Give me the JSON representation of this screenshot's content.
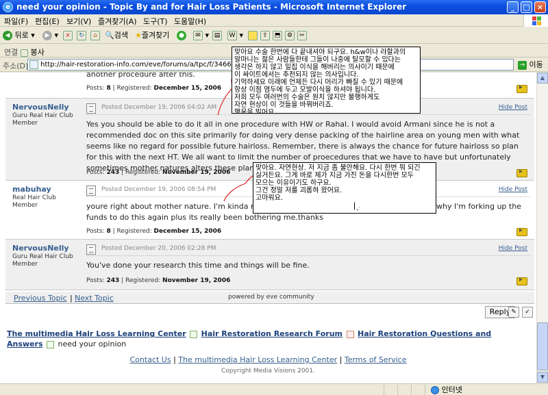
{
  "window": {
    "title": "need your opinion - Topic By and for Hair Loss Patients - Microsoft Internet Explorer",
    "ie_icon": "e"
  },
  "menu": [
    "파일(F)",
    "편집(E)",
    "보기(V)",
    "즐겨찾기(A)",
    "도구(T)",
    "도움말(H)"
  ],
  "toolbar": {
    "back": "뒤로",
    "search": "검색",
    "favorites": "즐겨찾기"
  },
  "links_bar": {
    "label": "연결",
    "item": "봉사"
  },
  "address": {
    "label": "주소(D)",
    "url": "http://hair-restoration-info.com/eve/forums/a/tpc/f/346606086",
    "go": "이동"
  },
  "posts": [
    {
      "tail_text": "another procedure after this.",
      "posts_count": "8",
      "registered": "December 15, 2006"
    },
    {
      "author": "NervousNelly",
      "role": "Guru Real Hair Club",
      "status": "Member",
      "date": "Posted December 19, 2006 04:02 AM",
      "hide": "Hide Post",
      "body": "Yes you should be able to do it all in one procedure with HW or Rahal. I would avoid Armani since he is not a recommended doc on this site primarily for doing very dense packing of the hairline area on young men with what seems like no regard for possible future hairloss. Remember, there is always the chance for future hairloss so plan for this with the next HT. We all want to limit the number of proecedures that we have to have but unfortunately sometimes mother natures alters these plans. Good luck.",
      "posts_count": "243",
      "registered": "November 19, 2006"
    },
    {
      "author": "mabuhay",
      "role": "Real Hair Club",
      "status": "Member",
      "date": "Posted December 19, 2006 08:54 PM",
      "hide": "Hide Post",
      "body": "youre right about mother nature. I'm kinda nervous coz i'd hate to get f      up again. That is why I'm forking up the funds to do this again plus its really been bothering me.thanks",
      "posts_count": "8",
      "registered": "December 15, 2006"
    },
    {
      "author": "NervousNelly",
      "role": "Guru Real Hair Club",
      "status": "Member",
      "date": "Posted December 20, 2006 02:28 PM",
      "hide": "Hide Post",
      "body": "You've done your research this time and things will be fine.",
      "posts_count": "243",
      "registered": "November 19, 2006"
    }
  ],
  "labels": {
    "posts": "Posts:",
    "registered": "| Registered:"
  },
  "nav": {
    "previous": "Previous Topic",
    "sep": "|",
    "next": "Next Topic",
    "powered": "powered by eve community"
  },
  "reply": "Reply",
  "breadcrumb": {
    "item1": "The multimedia Hair Loss Learning Center",
    "item2": "Hair Restoration Research Forum",
    "item3": "Hair Restoration Questions and Answers",
    "item4": "need your opinion"
  },
  "footer": {
    "contact": "Contact Us",
    "center": "The multimedia Hair Loss Learning Center",
    "terms": "Terms of Service",
    "sep": "|",
    "copyright": "Copyright Media Visions 2001."
  },
  "notes": {
    "note1": "맞아요 수술 한번에 다 끝내셔야 되구요. h&w이나 라할과의\n알마니는 젊은 사람들한테 그들이 나중에 탈모할 수 있다는\n생각은 하지 않고 밀집 이식을 해버리는 의사이기 때문에\n이 싸이트에서는 추천되지 않는 의사입니다.\n기억하세요 미래에 언제든 다시 머리가 빠질 수 있기 때문에\n항상 이점 염두에 두고 모발이식을 하셔야 됩니다.\n저희 모두 여러번의 수술은 원치 않지만 불행하게도\n자연 현상이 이 것들을 바꿔버리죠.\n행운을 빌어요.",
    "note2": "맞아요. 자연현상. 저 지금 좀 불안해요. 다시 한번 뭐 되긴\n싫거든요. 그게 바로 제가 지금 가진 돈을 다시한번 모두\n모으는 이유이기도 하구요.\n그건 정말 저를 괴롭혀 왔어요.\n고마워요."
  },
  "status": {
    "zone": "인터넷"
  }
}
